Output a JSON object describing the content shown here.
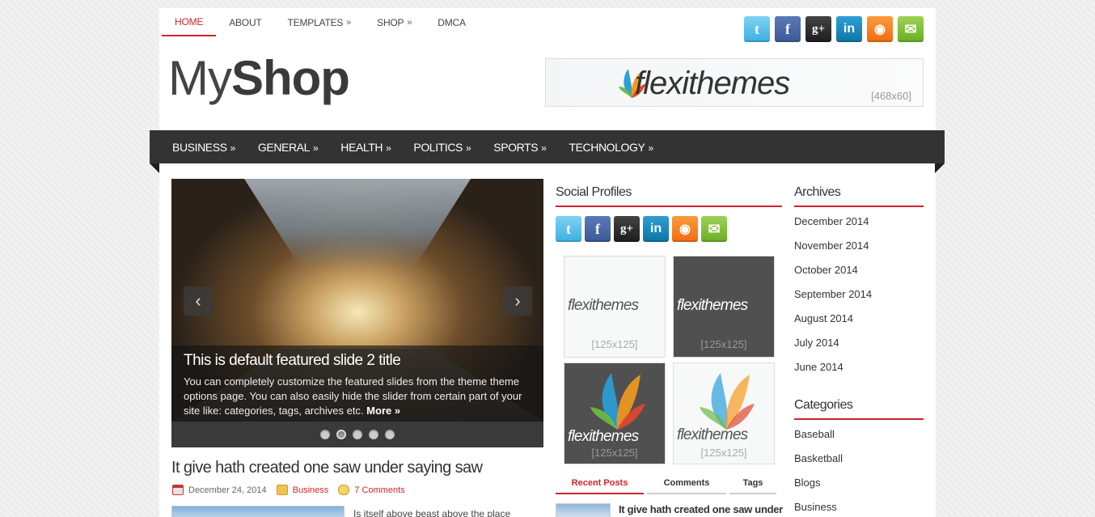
{
  "top_nav": [
    {
      "label": "HOME",
      "active": true,
      "has_sub": false
    },
    {
      "label": "ABOUT",
      "active": false,
      "has_sub": false
    },
    {
      "label": "TEMPLATES",
      "active": false,
      "has_sub": true
    },
    {
      "label": "SHOP",
      "active": false,
      "has_sub": true
    },
    {
      "label": "DMCA",
      "active": false,
      "has_sub": false
    }
  ],
  "submenu_arrow": "»",
  "logo": {
    "part1": "My",
    "part2": "Shop"
  },
  "banner": {
    "brand": "flexithemes",
    "size": "[468x60]"
  },
  "categories": [
    "BUSINESS",
    "GENERAL",
    "HEALTH",
    "POLITICS",
    "SPORTS",
    "TECHNOLOGY"
  ],
  "slider": {
    "title": "This is default featured slide 2 title",
    "description": "You can completely customize the featured slides from the theme theme options page. You can also easily hide the slider from certain part of your site like: categories, tags, archives etc.",
    "more": "More »",
    "prev": "‹",
    "next": "›",
    "dots": 5,
    "active_dot": 2
  },
  "post": {
    "title": "It give hath created one saw under saying saw",
    "date": "December 24, 2014",
    "category": "Business",
    "comments": "7 Comments",
    "excerpt": "Is itself above beast above the place"
  },
  "social_profiles": {
    "title": "Social Profiles"
  },
  "social_icons": [
    {
      "name": "twitter",
      "glyph": "t"
    },
    {
      "name": "facebook",
      "glyph": "f"
    },
    {
      "name": "google-plus",
      "glyph": "g+"
    },
    {
      "name": "linkedin",
      "glyph": "in"
    },
    {
      "name": "rss",
      "glyph": "◉"
    },
    {
      "name": "email",
      "glyph": "✉"
    }
  ],
  "ads125": [
    {
      "brand": "flexithemes",
      "size": "[125x125]"
    },
    {
      "brand": "flexithemes",
      "size": "[125x125]"
    },
    {
      "brand": "flexithemes",
      "size": "[125x125]"
    },
    {
      "brand": "flexithemes",
      "size": "[125x125]"
    }
  ],
  "tabs": [
    "Recent Posts",
    "Comments",
    "Tags"
  ],
  "recent_post_title": "It give hath created one saw under",
  "archives": {
    "title": "Archives",
    "items": [
      "December 2014",
      "November 2014",
      "October 2014",
      "September 2014",
      "August 2014",
      "July 2014",
      "June 2014"
    ]
  },
  "categories_widget": {
    "title": "Categories",
    "items": [
      "Baseball",
      "Basketball",
      "Blogs",
      "Business"
    ]
  },
  "colors": {
    "accent": "#d2232a",
    "nav_bg": "#333333"
  }
}
